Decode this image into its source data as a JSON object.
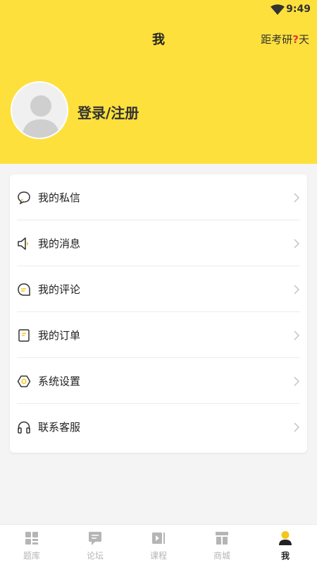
{
  "status": {
    "time": "9:49"
  },
  "header": {
    "title": "我",
    "countdown_prefix": "距考研",
    "countdown_value": "?",
    "countdown_suffix": "天",
    "login_label": "登录/注册"
  },
  "menu": {
    "items": [
      {
        "label": "我的私信",
        "icon": "chat-bubble-icon"
      },
      {
        "label": "我的消息",
        "icon": "speaker-icon"
      },
      {
        "label": "我的评论",
        "icon": "comment-icon"
      },
      {
        "label": "我的订单",
        "icon": "order-icon"
      },
      {
        "label": "系统设置",
        "icon": "settings-icon"
      },
      {
        "label": "联系客服",
        "icon": "headphones-icon"
      }
    ]
  },
  "tabs": [
    {
      "label": "题库",
      "icon": "grid-icon"
    },
    {
      "label": "论坛",
      "icon": "forum-icon"
    },
    {
      "label": "课程",
      "icon": "video-icon"
    },
    {
      "label": "商城",
      "icon": "store-icon"
    },
    {
      "label": "我",
      "icon": "profile-icon",
      "active": true
    }
  ],
  "colors": {
    "header_bg": "#fde03c",
    "accent": "#f5c518",
    "inactive_tab": "#b5b5b5"
  }
}
